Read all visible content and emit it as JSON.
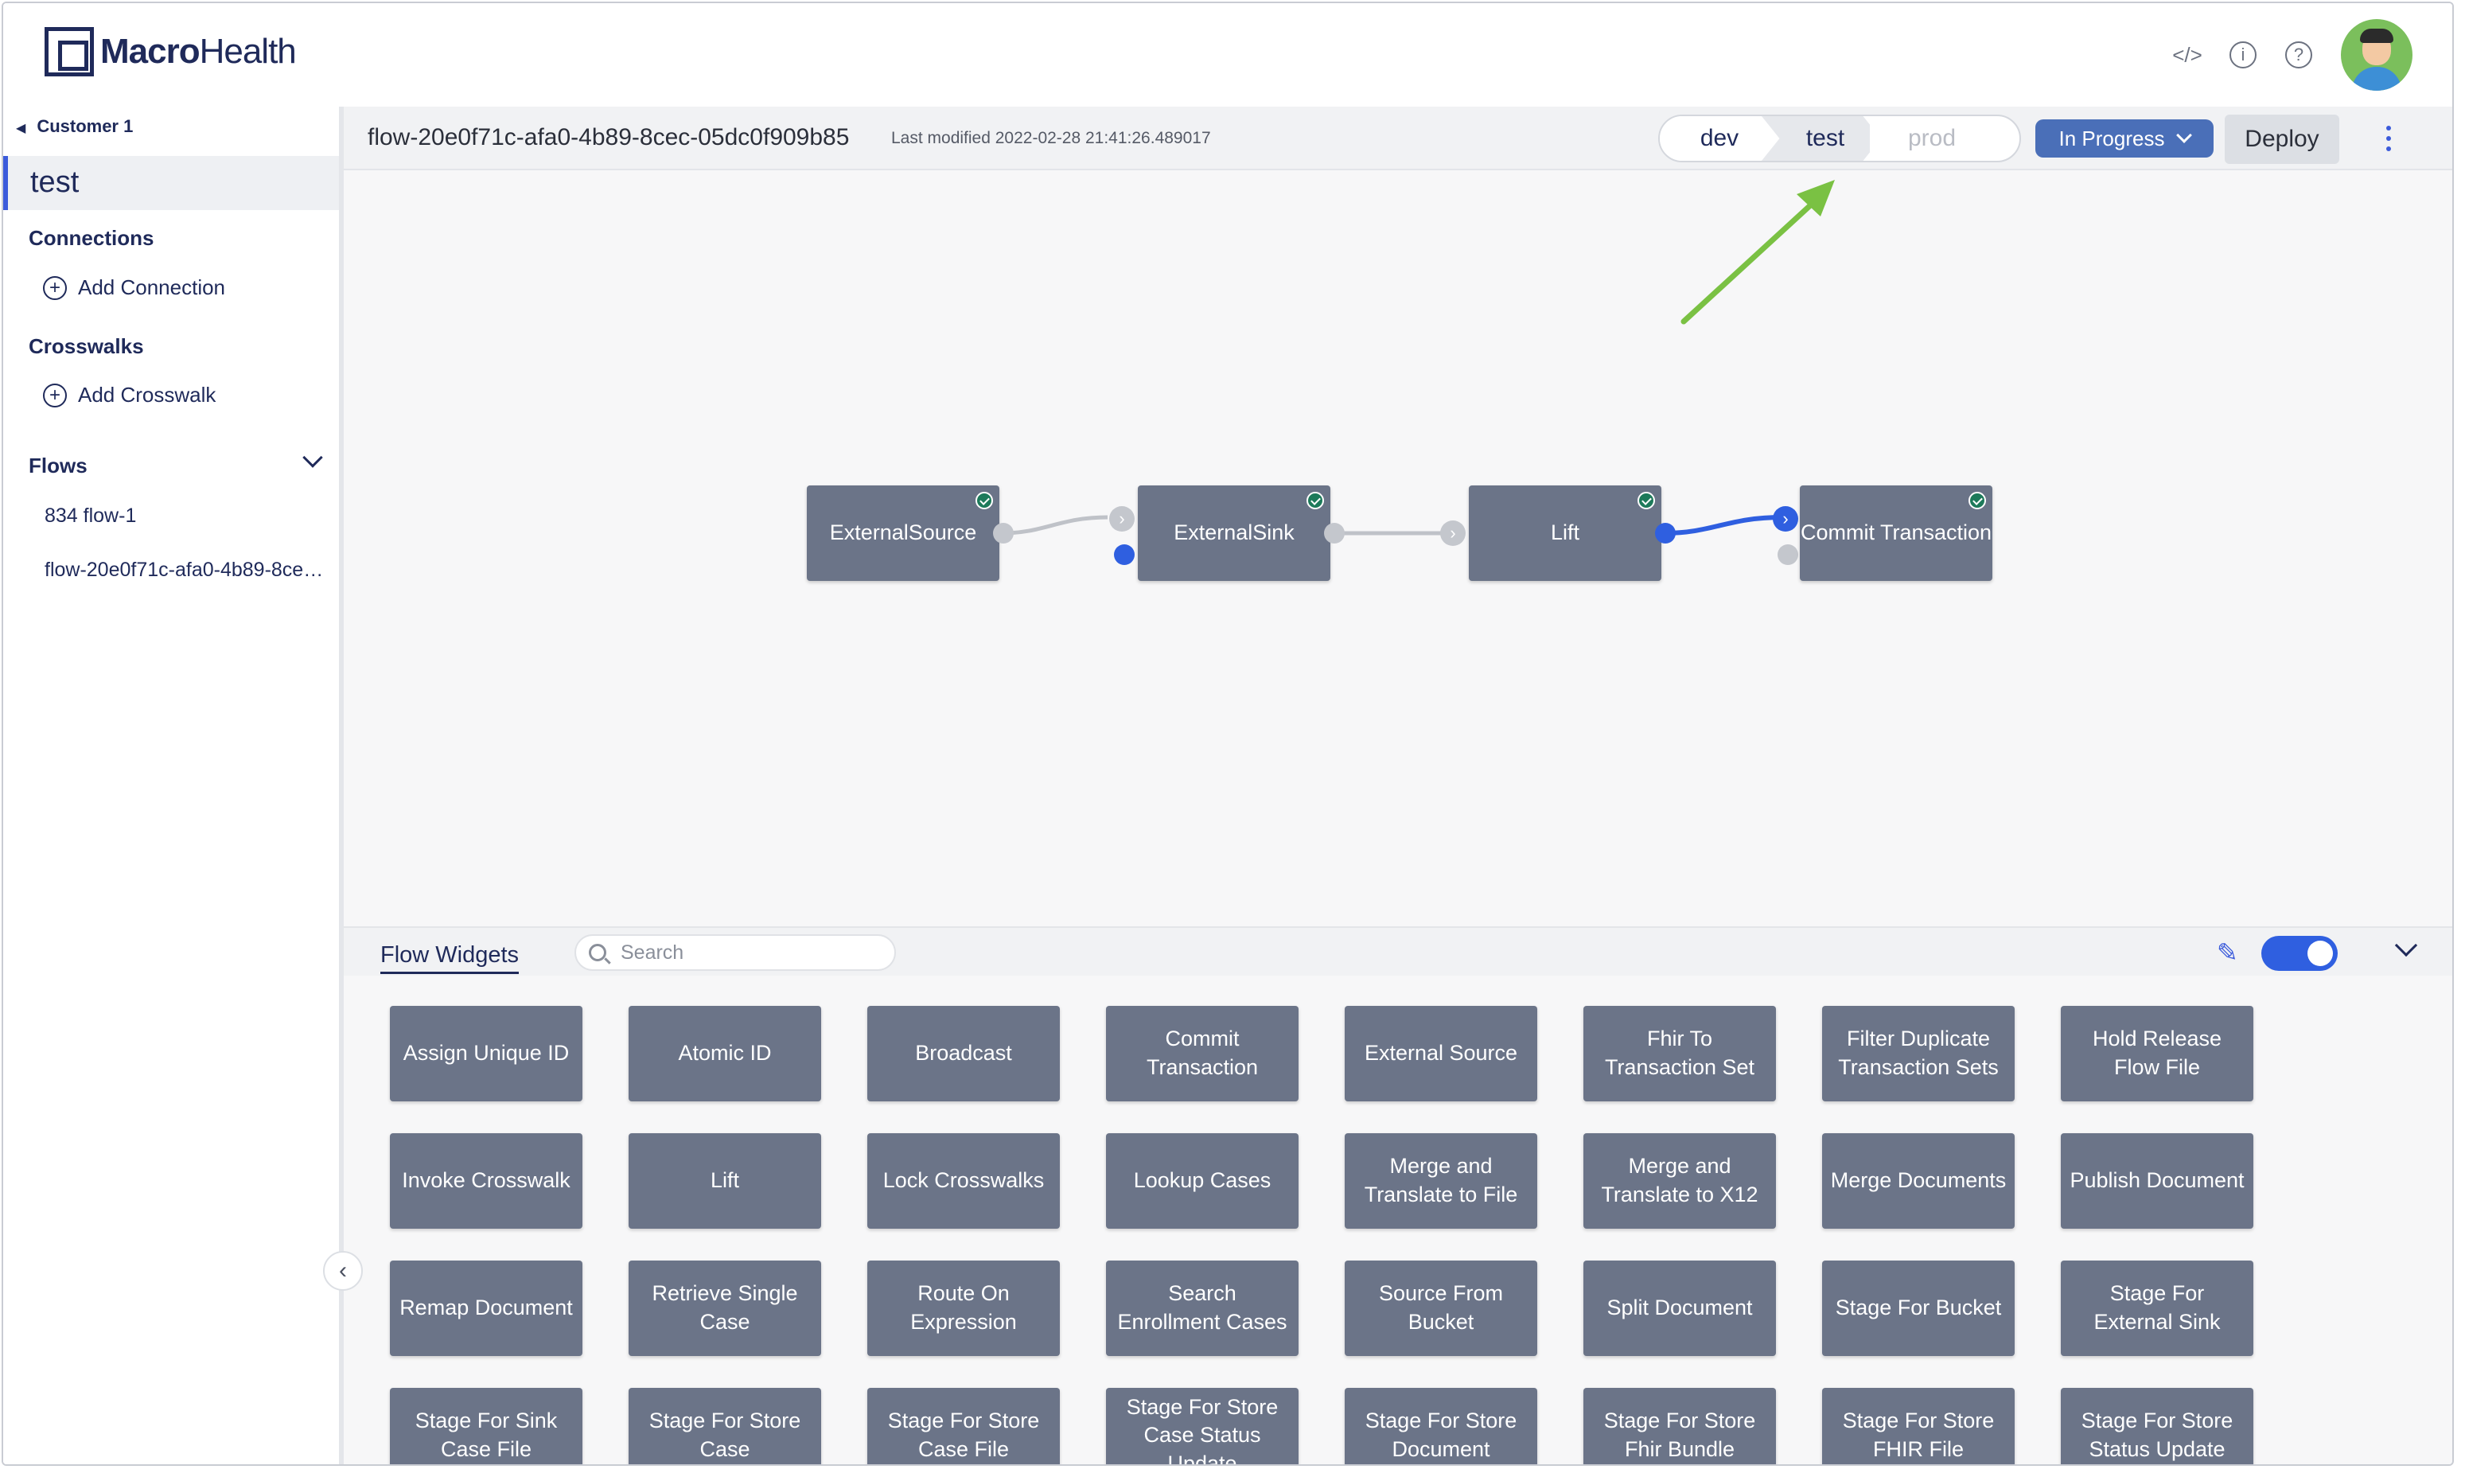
{
  "app": {
    "logo_bold": "Macro",
    "logo_rest": "Health"
  },
  "topbar": {
    "icons": [
      "code-icon",
      "info-icon",
      "help-icon"
    ],
    "avatar": "user-avatar"
  },
  "sidebar": {
    "customer": "Customer 1",
    "selected": "test",
    "connections": {
      "title": "Connections",
      "add": "Add Connection"
    },
    "crosswalks": {
      "title": "Crosswalks",
      "add": "Add Crosswalk"
    },
    "flows": {
      "title": "Flows",
      "items": [
        "834 flow-1",
        "flow-20e0f71c-afa0-4b89-8cec-05dc0f909b85"
      ]
    }
  },
  "flowbar": {
    "title": "flow-20e0f71c-afa0-4b89-8cec-05dc0f909b85",
    "modified": "Last modified 2022-02-28 21:41:26.489017",
    "stages": [
      "dev",
      "test",
      "prod"
    ],
    "active_stage": "test",
    "status": "In Progress",
    "deploy": "Deploy"
  },
  "canvas": {
    "nodes": [
      {
        "label": "ExternalSource",
        "validated": true
      },
      {
        "label": "ExternalSink",
        "validated": true
      },
      {
        "label": "Lift",
        "validated": true
      },
      {
        "label": "Commit Transaction",
        "validated": true
      }
    ]
  },
  "widgets_panel": {
    "tab": "Flow Widgets",
    "search_placeholder": "Search",
    "toggle_on": true,
    "items": [
      "Assign Unique ID",
      "Atomic ID",
      "Broadcast",
      "Commit Transaction",
      "External Source",
      "Fhir To Transaction Set",
      "Filter Duplicate Transaction Sets",
      "Hold Release Flow File",
      "Invoke Crosswalk",
      "Lift",
      "Lock Crosswalks",
      "Lookup Cases",
      "Merge and Translate to File",
      "Merge and Translate to X12",
      "Merge Documents",
      "Publish Document",
      "Remap Document",
      "Retrieve Single Case",
      "Route On Expression",
      "Search Enrollment Cases",
      "Source From Bucket",
      "Split Document",
      "Stage For Bucket",
      "Stage For External Sink",
      "Stage For Sink Case File",
      "Stage For Store Case",
      "Stage For Store Case File",
      "Stage For Store Case Status Update",
      "Stage For Store Document",
      "Stage For Store Fhir Bundle",
      "Stage For Store FHIR File",
      "Stage For Store Status Update"
    ]
  },
  "colors": {
    "accent": "#2f5fe0",
    "node": "#6b7488",
    "brand": "#1f2a5a",
    "annotation": "#7ac143"
  }
}
